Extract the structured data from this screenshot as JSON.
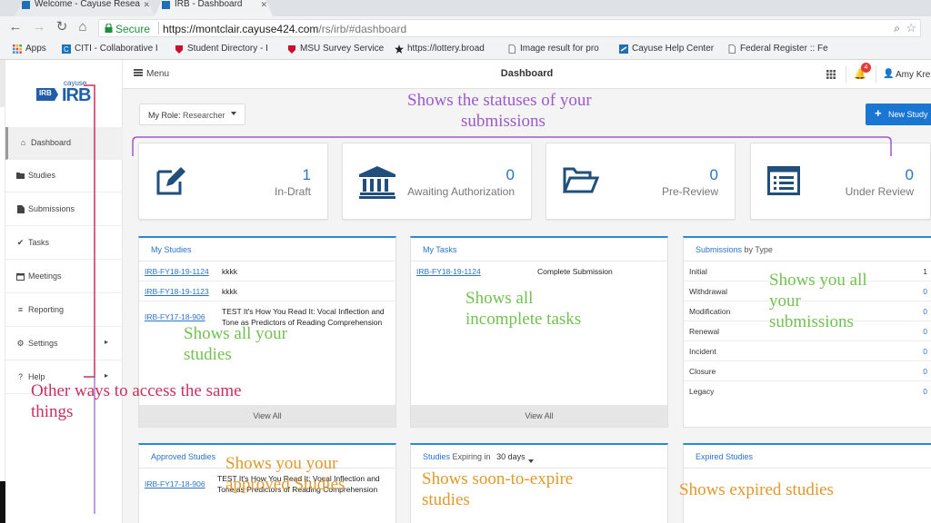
{
  "browser": {
    "tabs": [
      {
        "label": "Welcome - Cayuse Resea"
      },
      {
        "label": "IRB - Dashboard"
      }
    ],
    "secure_label": "Secure",
    "url_host": "https://montclair.cayuse424.com",
    "url_path": "/rs/irb/#dashboard",
    "bookmarks": [
      {
        "label": "Apps"
      },
      {
        "label": "CITI - Collaborative I"
      },
      {
        "label": "Student Directory - I"
      },
      {
        "label": "MSU Survey Service"
      },
      {
        "label": "https://lottery.broad"
      },
      {
        "label": "Image result for pro"
      },
      {
        "label": "Cayuse Help Center"
      },
      {
        "label": "Federal Register :: Fe"
      }
    ]
  },
  "sidebar": {
    "logo_small": "cayuse",
    "logo_mark": "IRB",
    "logo_big": "IRB",
    "items": [
      {
        "label": "Dashboard",
        "icon": "home-icon"
      },
      {
        "label": "Studies",
        "icon": "folder-icon"
      },
      {
        "label": "Submissions",
        "icon": "document-icon"
      },
      {
        "label": "Tasks",
        "icon": "check-icon"
      },
      {
        "label": "Meetings",
        "icon": "calendar-icon"
      },
      {
        "label": "Reporting",
        "icon": "list-icon"
      },
      {
        "label": "Settings",
        "icon": "gear-icon"
      },
      {
        "label": "Help",
        "icon": "question-icon"
      }
    ]
  },
  "topnav": {
    "menu_label": "Menu",
    "title": "Dashboard",
    "notification_count": "4",
    "user_name": "Amy Kre"
  },
  "role": {
    "key": "My Role:",
    "value": "Researcher"
  },
  "new_study_label": "New Study",
  "stats": [
    {
      "count": "1",
      "label": "In-Draft",
      "icon": "edit-icon"
    },
    {
      "count": "0",
      "label": "Awaiting Authorization",
      "icon": "bank-icon"
    },
    {
      "count": "0",
      "label": "Pre-Review",
      "icon": "folder-open-icon"
    },
    {
      "count": "0",
      "label": "Under Review",
      "icon": "list-alt-icon"
    }
  ],
  "my_studies": {
    "title_a": "My",
    "title_b": "Studies",
    "rows": [
      {
        "id": "IRB-FY18-19-1124",
        "title": "kkkk"
      },
      {
        "id": "IRB-FY18-19-1123",
        "title": "kkkk"
      },
      {
        "id": "IRB-FY17-18-906",
        "title": "TEST It's How You Read It: Vocal Inflection and Tone as Predictors of Reading Comprehension"
      }
    ],
    "view_all": "View All"
  },
  "my_tasks": {
    "title_a": "My",
    "title_b": "Tasks",
    "rows": [
      {
        "id": "IRB-FY18-19-1124",
        "title": "Complete Submission"
      }
    ],
    "view_all": "View All"
  },
  "submissions_by_type": {
    "title_a": "Submissions",
    "title_b": "by Type",
    "rows": [
      {
        "label": "Initial",
        "value": "1"
      },
      {
        "label": "Withdrawal",
        "value": "0"
      },
      {
        "label": "Modification",
        "value": "0"
      },
      {
        "label": "Renewal",
        "value": "0"
      },
      {
        "label": "Incident",
        "value": "0"
      },
      {
        "label": "Closure",
        "value": "0"
      },
      {
        "label": "Legacy",
        "value": "0"
      }
    ]
  },
  "approved_studies": {
    "title_a": "Approved",
    "title_b": "Studies",
    "rows": [
      {
        "id": "IRB-FY17-18-906",
        "title": "TEST It's How You Read It: Vocal Inflection and Tone as Predictors of Reading Comprehension"
      }
    ]
  },
  "expiring_studies": {
    "title_a": "Studies",
    "title_b": "Expiring in",
    "days": "30 days"
  },
  "expired_studies": {
    "title_a": "Expired",
    "title_b": "Studies"
  },
  "annotations": {
    "statuses_line1": "Shows the statuses of your",
    "statuses_line2": "submissions",
    "studies_line1": "Shows all your",
    "studies_line2": "studies",
    "tasks_line1": "Shows all",
    "tasks_line2": "incomplete tasks",
    "subs_line1": "Shows you all",
    "subs_line2": "your",
    "subs_line3": "submissions",
    "other_line1": "Other ways to access the same",
    "other_line2": "things",
    "approved_line1": "Shows you your",
    "approved_line2": "approved Studies",
    "expiring_line1": "Shows soon-to-expire",
    "expiring_line2": "studies",
    "expired": "Shows expired studies"
  },
  "colors": {
    "accent_blue": "#2a73c9",
    "annotation_purple": "#9b59c9",
    "annotation_green": "#72c152",
    "annotation_red": "#c9305f",
    "annotation_orange": "#e0992b"
  }
}
